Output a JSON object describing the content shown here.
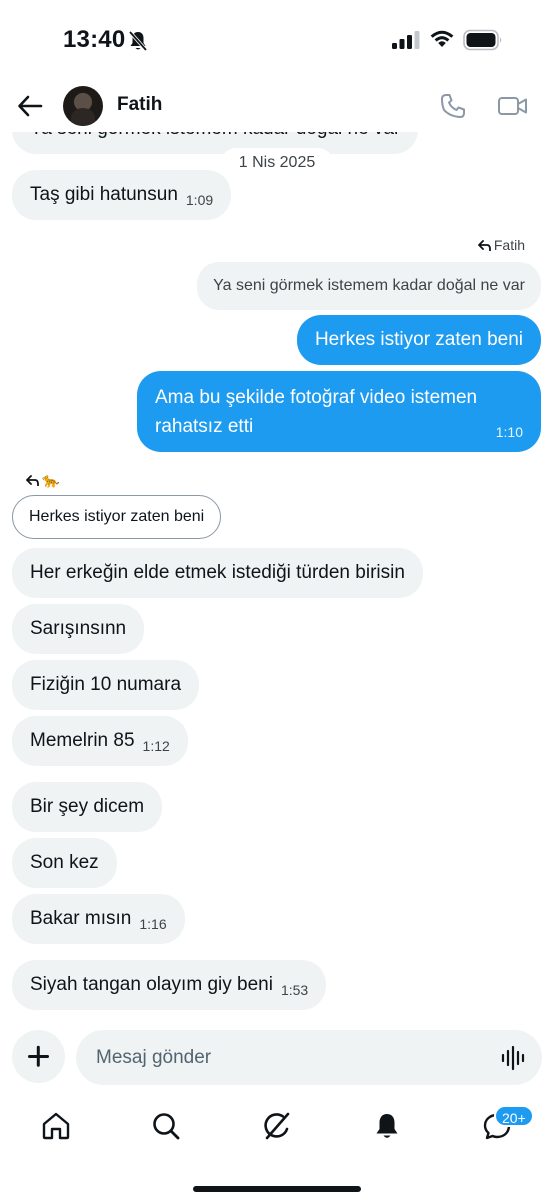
{
  "status_bar": {
    "time": "13:40"
  },
  "header": {
    "contact_name": "Fatih"
  },
  "messages": {
    "top_partial": "Ya seni görmek istemem kadar doğal ne var",
    "date_separator": "1 Nis 2025",
    "incoming_1": {
      "text": "Taş gibi hatunsun",
      "time": "1:09"
    },
    "reply_to_label": "Fatih",
    "quoted_message": "Ya seni görmek istemem kadar doğal ne var",
    "outgoing_1": {
      "text": "Herkes istiyor zaten beni"
    },
    "outgoing_2": {
      "line1": "Ama bu şekilde fotoğraf video istemen",
      "line2": "rahatsız etti",
      "time": "1:10"
    },
    "reply_to_emoji": "🐆",
    "reply_chip": "Herkes istiyor zaten beni",
    "incoming_2": {
      "text": "Her erkeğin elde etmek istediği türden birisin"
    },
    "incoming_3": {
      "text": "Sarışınsınn"
    },
    "incoming_4": {
      "text": "Fiziğin 10 numara"
    },
    "incoming_5": {
      "text": "Memelrin 85",
      "time": "1:12"
    },
    "incoming_6": {
      "text": "Bir şey dicem"
    },
    "incoming_7": {
      "text": "Son kez"
    },
    "incoming_8": {
      "text": "Bakar mısın",
      "time": "1:16"
    },
    "incoming_9": {
      "text": "Siyah tangan olayım giy beni",
      "time": "1:53"
    }
  },
  "composer": {
    "placeholder": "Mesaj gönder"
  },
  "bottom_nav": {
    "items": [
      "home-icon",
      "search-icon",
      "grok-icon",
      "notifications-icon",
      "messages-icon"
    ],
    "messages_badge": "20+"
  },
  "colors": {
    "accent": "#1d9bf0",
    "incoming_bubble": "#eff3f4",
    "text": "#0f1419"
  }
}
